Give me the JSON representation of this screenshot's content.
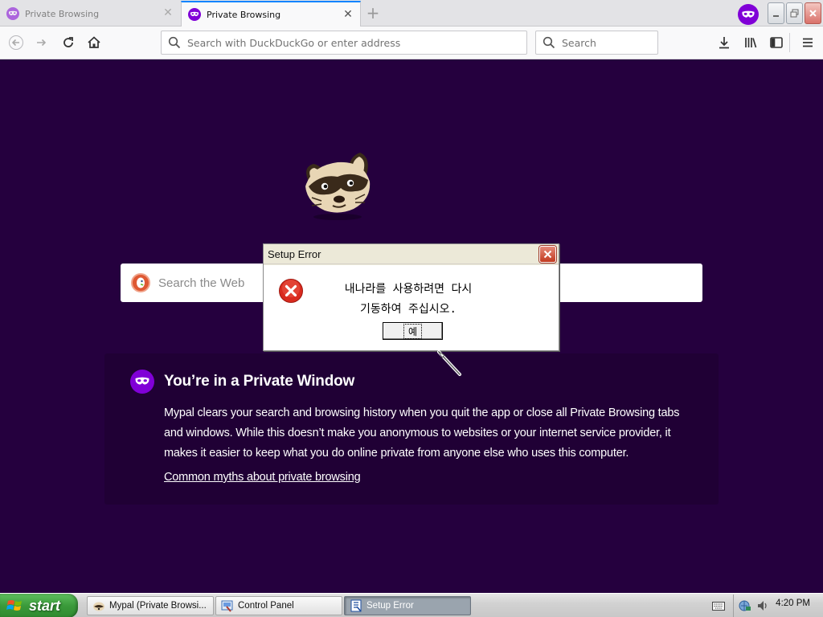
{
  "browser": {
    "tabs": [
      {
        "label": "Private Browsing",
        "active": false
      },
      {
        "label": "Private Browsing",
        "active": true
      }
    ],
    "new_tab_label": "+",
    "url_placeholder": "Search with DuckDuckGo or enter address",
    "search_placeholder": "Search",
    "accent_color": "#8000d7"
  },
  "page": {
    "search_placeholder": "Search the Web",
    "private_heading": "You’re in a Private Window",
    "private_body": "Mypal clears your search and browsing history when you quit the app or close all Private Browsing tabs and windows. While this doesn’t make you anonymous to websites or your internet service provider, it makes it easier to keep what you do online private from anyone else who uses this computer.",
    "myths_link": "Common myths about private browsing",
    "background_color": "#25003e"
  },
  "dialog": {
    "title": "Setup Error",
    "message": "내나라를 사용하려면 다시\n기동하여 주십시오.",
    "ok_label": "예",
    "icon": "error-icon"
  },
  "taskbar": {
    "start_label": "start",
    "items": [
      {
        "label": "Mypal (Private Browsi...",
        "icon": "mypal-icon",
        "active": false
      },
      {
        "label": "Control Panel",
        "icon": "control-panel-icon",
        "active": false
      },
      {
        "label": "Setup Error",
        "icon": "setup-icon",
        "active": true
      }
    ],
    "clock": "4:20 PM"
  }
}
